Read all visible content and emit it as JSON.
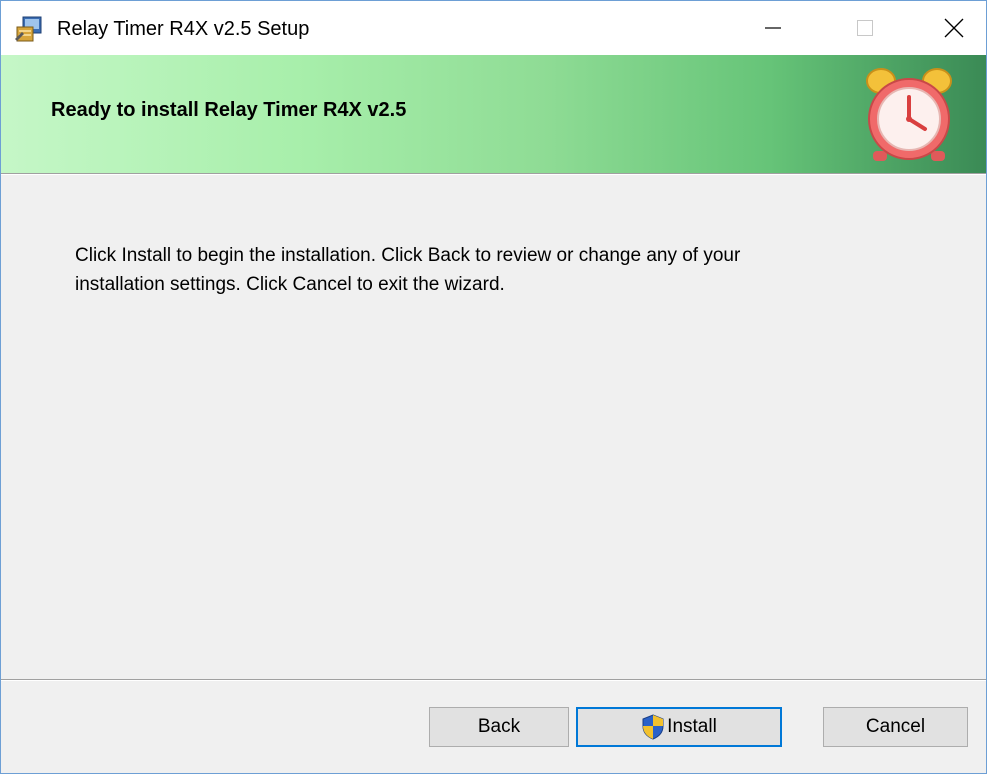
{
  "window": {
    "title": "Relay Timer R4X v2.5 Setup"
  },
  "banner": {
    "title": "Ready to install Relay Timer R4X v2.5",
    "gradient_colors": [
      "#c5f7c7",
      "#8fdc95",
      "#3a8a55"
    ],
    "icon": "alarm-clock-icon"
  },
  "body": {
    "line1": "Click Install to begin the installation. Click Back to review or change any of your",
    "line2": "installation settings. Click Cancel to exit the wizard."
  },
  "buttons": {
    "back": "Back",
    "install": "Install",
    "cancel": "Cancel"
  },
  "icons": {
    "app": "installer-app-icon",
    "minimize": "minimize-icon",
    "maximize": "maximize-icon",
    "close": "close-icon",
    "uac": "uac-shield-icon"
  },
  "colors": {
    "focus_border": "#0078d7",
    "accent": "#6d9fd5"
  }
}
